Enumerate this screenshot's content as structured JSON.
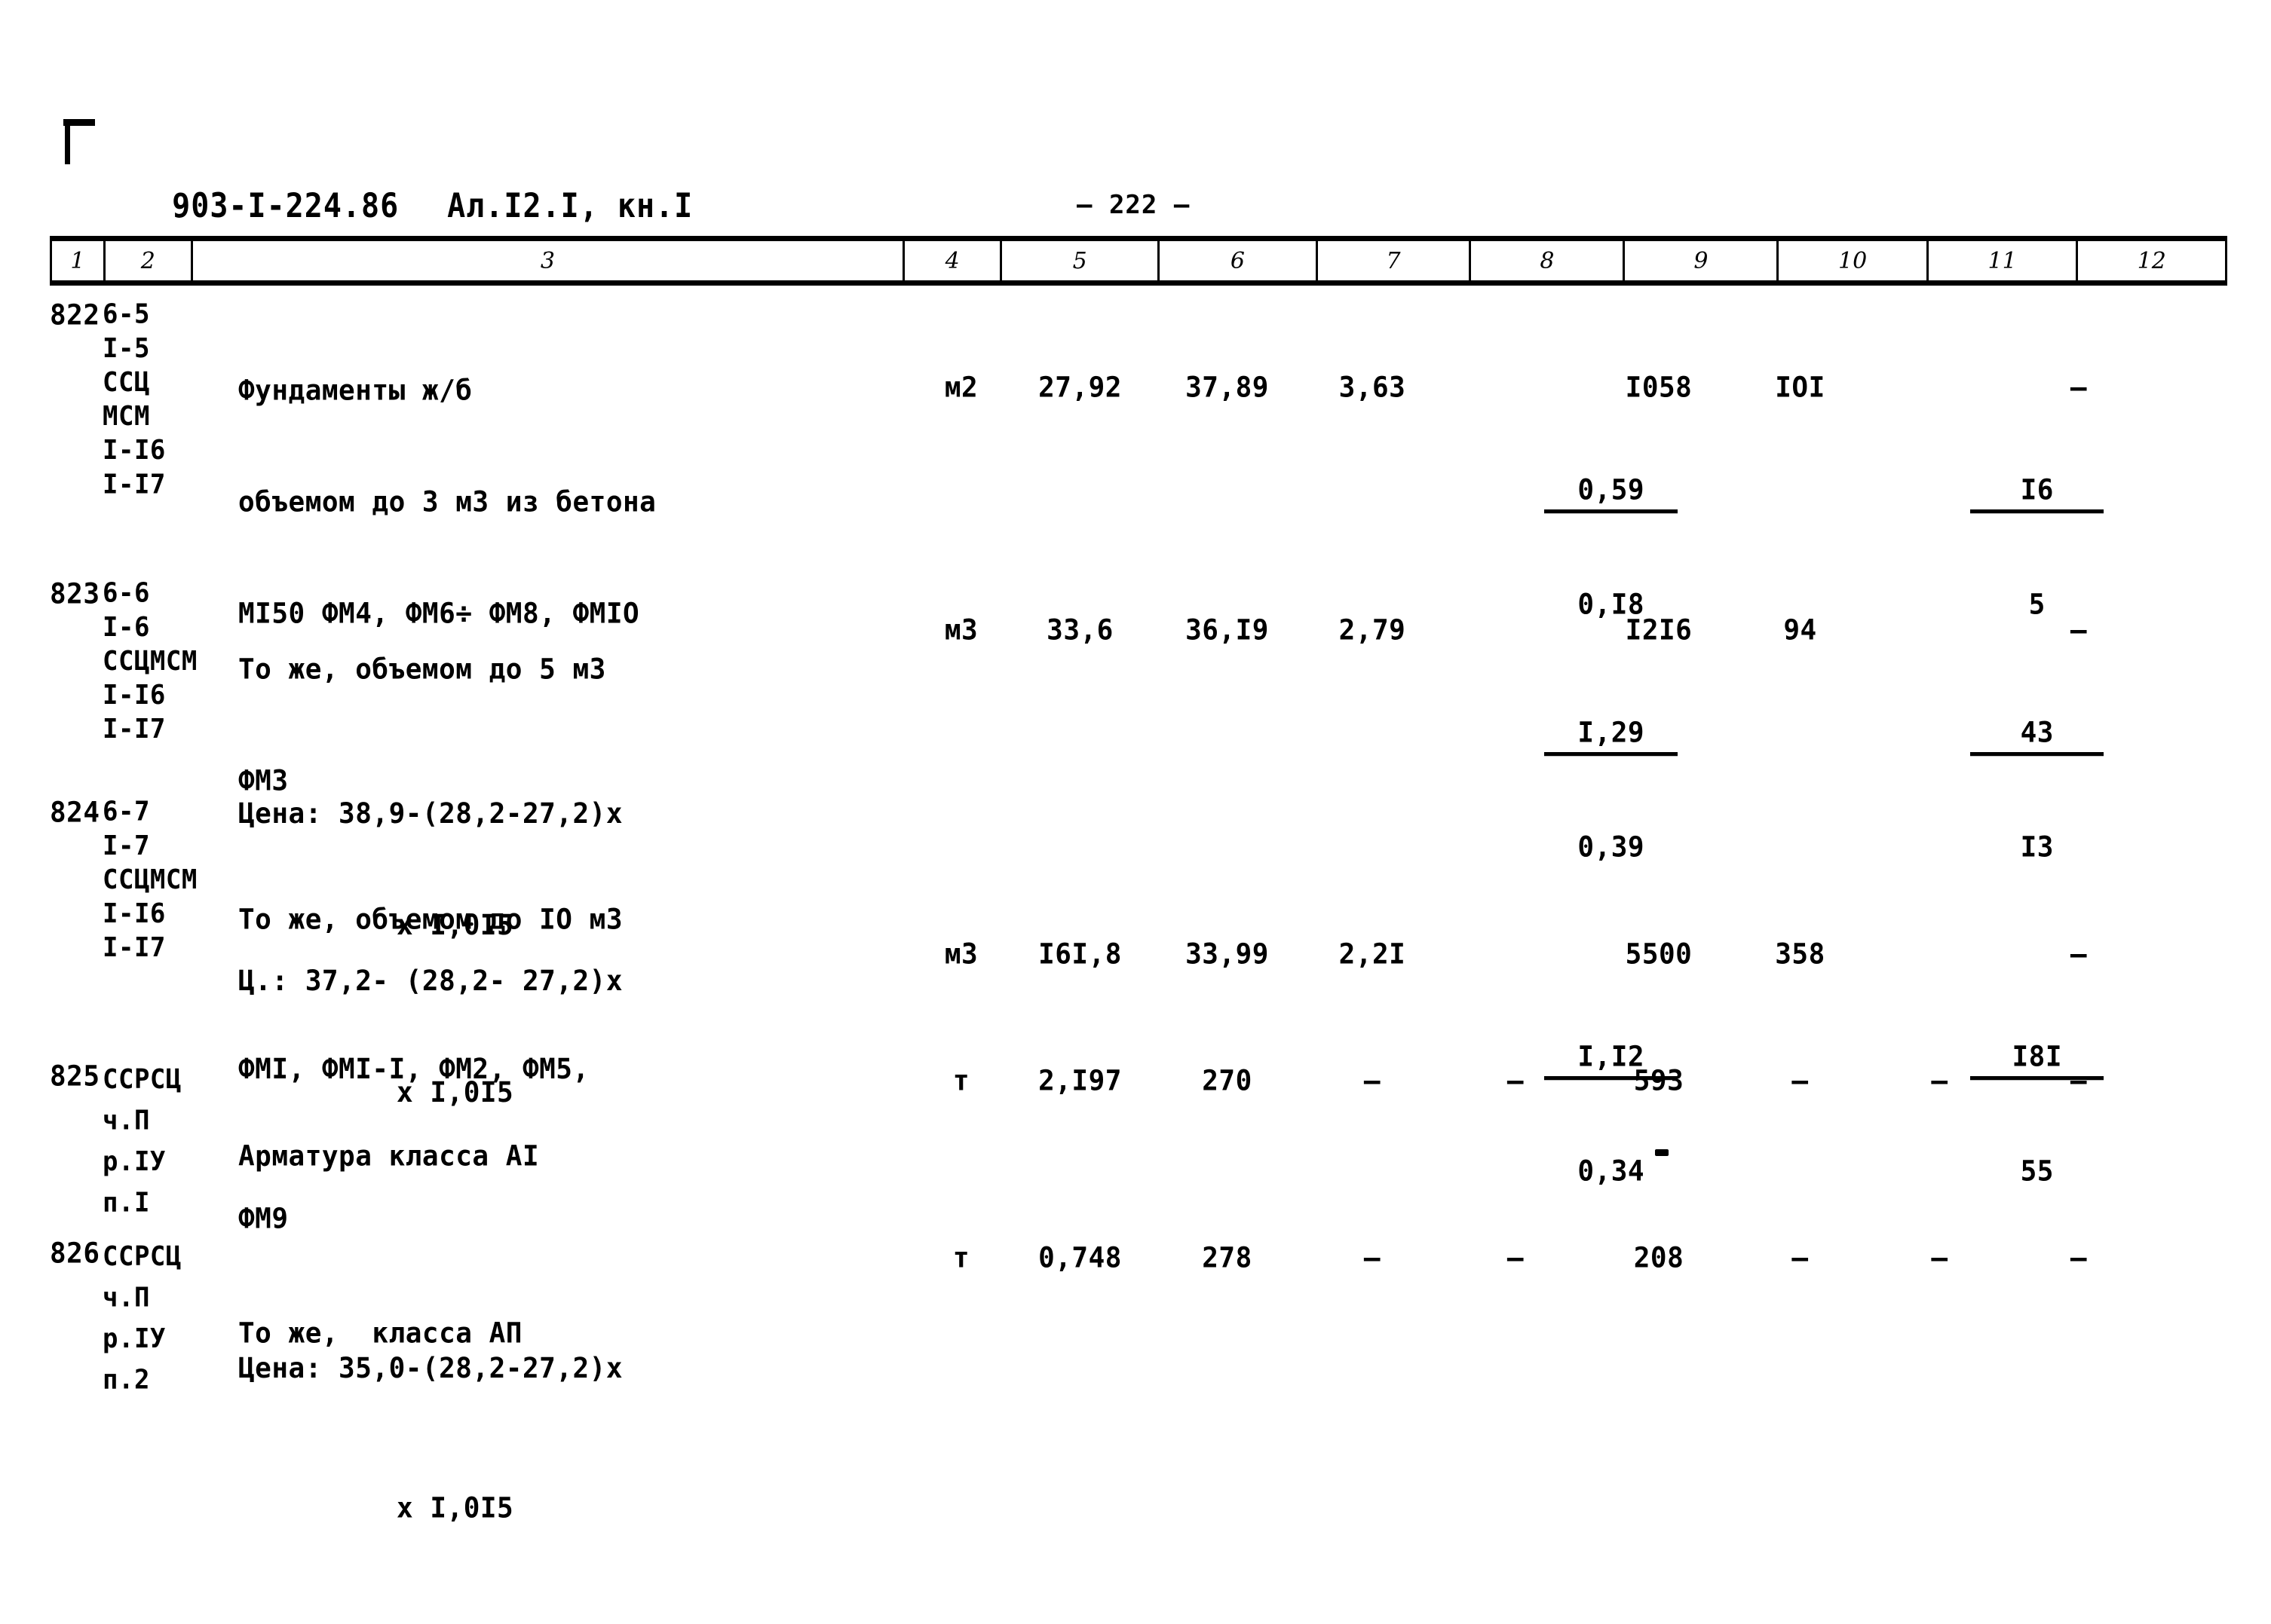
{
  "header": {
    "document_code": "903-I-224.86",
    "album": "Ал.I2.I, кн.I",
    "page_number": "— 222 —"
  },
  "table": {
    "column_headers": [
      "1",
      "2",
      "3",
      "4",
      "5",
      "6",
      "7",
      "8",
      "9",
      "10",
      "11",
      "12"
    ],
    "rows": [
      {
        "num": "822",
        "code": "6-5\nI-5\nССЦ\nМСМ\nI-I6\nI-I7",
        "description_line1": "Фундаменты ж/б",
        "description_line2": "объемом до 3 м3 из бетона",
        "description_line3": "МI50 ФМ4, ФМ6÷ ФМ8, ФМIО",
        "description_price1": "Цена: 38,9-(28,2-27,2)х",
        "description_price2": "х I,0I5",
        "unit": "м2",
        "col5": "27,92",
        "col6": "37,89",
        "col7": "3,63",
        "col8_top": "0,59",
        "col8_bot": "0,I8",
        "col9": "I058",
        "col10": "IOI",
        "col11_top": "I6",
        "col11_bot": "5",
        "col12": "–"
      },
      {
        "num": "823",
        "code": "6-6\nI-6\nССЦМСМ\nI-I6\nI-I7",
        "description_line1": "То же, объемом до 5 м3",
        "description_line2": "ФМЗ",
        "description_price1": "Ц.: 37,2- (28,2- 27,2)х",
        "description_price2": "х I,0I5",
        "unit": "м3",
        "col5": "33,6",
        "col6": "36,I9",
        "col7": "2,79",
        "col8_top": "I,29",
        "col8_bot": "0,39",
        "col9": "I2I6",
        "col10": "94",
        "col11_top": "43",
        "col11_bot": "I3",
        "col12": "–"
      },
      {
        "num": "824",
        "code": "6-7\nI-7\nССЦМСМ\nI-I6\nI-I7",
        "description_line1": "То же, объемом до IО м3",
        "description_line2": "ФМI, ФМI-I, ФМ2, ФМ5,",
        "description_line3": "ФМ9",
        "description_price1": "Цена: 35,0-(28,2-27,2)х",
        "description_price2": "х I,0I5",
        "unit": "м3",
        "col5": "I6I,8",
        "col6": "33,99",
        "col7": "2,2I",
        "col8_top": "I,I2",
        "col8_bot": "0,34",
        "col9": "5500",
        "col10": "358",
        "col11_top": "I8I",
        "col11_bot": "55",
        "col12": "–"
      },
      {
        "num": "825",
        "code": "ССРСЦ\nч.П\nр.IУ\nп.I",
        "description_line1": "Арматура класса АI",
        "unit": "т",
        "col5": "2,I97",
        "col6": "270",
        "col7": "–",
        "col8": "–",
        "col9": "593",
        "col10": "–",
        "col11": "–",
        "col12": "–"
      },
      {
        "num": "826",
        "code": "ССРСЦ\nч.П\nр.IУ\nп.2",
        "description_line1": "То же,  класса АП",
        "unit": "т",
        "col5": "0,748",
        "col6": "278",
        "col7": "–",
        "col8": "–",
        "col9": "208",
        "col10": "–",
        "col11": "–",
        "col12": "–"
      }
    ]
  }
}
